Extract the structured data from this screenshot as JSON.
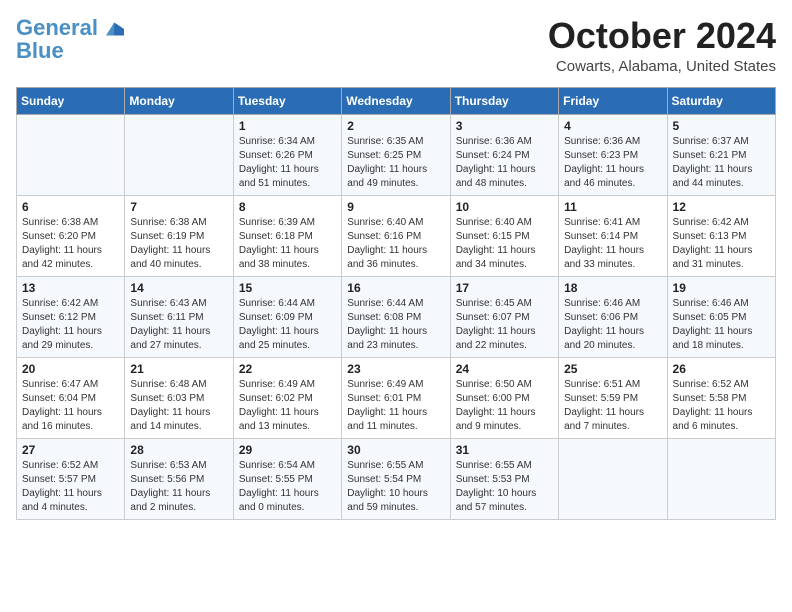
{
  "header": {
    "logo_line1": "General",
    "logo_line2": "Blue",
    "month": "October 2024",
    "location": "Cowarts, Alabama, United States"
  },
  "days_of_week": [
    "Sunday",
    "Monday",
    "Tuesday",
    "Wednesday",
    "Thursday",
    "Friday",
    "Saturday"
  ],
  "weeks": [
    [
      {
        "day": "",
        "content": ""
      },
      {
        "day": "",
        "content": ""
      },
      {
        "day": "1",
        "content": "Sunrise: 6:34 AM\nSunset: 6:26 PM\nDaylight: 11 hours\nand 51 minutes."
      },
      {
        "day": "2",
        "content": "Sunrise: 6:35 AM\nSunset: 6:25 PM\nDaylight: 11 hours\nand 49 minutes."
      },
      {
        "day": "3",
        "content": "Sunrise: 6:36 AM\nSunset: 6:24 PM\nDaylight: 11 hours\nand 48 minutes."
      },
      {
        "day": "4",
        "content": "Sunrise: 6:36 AM\nSunset: 6:23 PM\nDaylight: 11 hours\nand 46 minutes."
      },
      {
        "day": "5",
        "content": "Sunrise: 6:37 AM\nSunset: 6:21 PM\nDaylight: 11 hours\nand 44 minutes."
      }
    ],
    [
      {
        "day": "6",
        "content": "Sunrise: 6:38 AM\nSunset: 6:20 PM\nDaylight: 11 hours\nand 42 minutes."
      },
      {
        "day": "7",
        "content": "Sunrise: 6:38 AM\nSunset: 6:19 PM\nDaylight: 11 hours\nand 40 minutes."
      },
      {
        "day": "8",
        "content": "Sunrise: 6:39 AM\nSunset: 6:18 PM\nDaylight: 11 hours\nand 38 minutes."
      },
      {
        "day": "9",
        "content": "Sunrise: 6:40 AM\nSunset: 6:16 PM\nDaylight: 11 hours\nand 36 minutes."
      },
      {
        "day": "10",
        "content": "Sunrise: 6:40 AM\nSunset: 6:15 PM\nDaylight: 11 hours\nand 34 minutes."
      },
      {
        "day": "11",
        "content": "Sunrise: 6:41 AM\nSunset: 6:14 PM\nDaylight: 11 hours\nand 33 minutes."
      },
      {
        "day": "12",
        "content": "Sunrise: 6:42 AM\nSunset: 6:13 PM\nDaylight: 11 hours\nand 31 minutes."
      }
    ],
    [
      {
        "day": "13",
        "content": "Sunrise: 6:42 AM\nSunset: 6:12 PM\nDaylight: 11 hours\nand 29 minutes."
      },
      {
        "day": "14",
        "content": "Sunrise: 6:43 AM\nSunset: 6:11 PM\nDaylight: 11 hours\nand 27 minutes."
      },
      {
        "day": "15",
        "content": "Sunrise: 6:44 AM\nSunset: 6:09 PM\nDaylight: 11 hours\nand 25 minutes."
      },
      {
        "day": "16",
        "content": "Sunrise: 6:44 AM\nSunset: 6:08 PM\nDaylight: 11 hours\nand 23 minutes."
      },
      {
        "day": "17",
        "content": "Sunrise: 6:45 AM\nSunset: 6:07 PM\nDaylight: 11 hours\nand 22 minutes."
      },
      {
        "day": "18",
        "content": "Sunrise: 6:46 AM\nSunset: 6:06 PM\nDaylight: 11 hours\nand 20 minutes."
      },
      {
        "day": "19",
        "content": "Sunrise: 6:46 AM\nSunset: 6:05 PM\nDaylight: 11 hours\nand 18 minutes."
      }
    ],
    [
      {
        "day": "20",
        "content": "Sunrise: 6:47 AM\nSunset: 6:04 PM\nDaylight: 11 hours\nand 16 minutes."
      },
      {
        "day": "21",
        "content": "Sunrise: 6:48 AM\nSunset: 6:03 PM\nDaylight: 11 hours\nand 14 minutes."
      },
      {
        "day": "22",
        "content": "Sunrise: 6:49 AM\nSunset: 6:02 PM\nDaylight: 11 hours\nand 13 minutes."
      },
      {
        "day": "23",
        "content": "Sunrise: 6:49 AM\nSunset: 6:01 PM\nDaylight: 11 hours\nand 11 minutes."
      },
      {
        "day": "24",
        "content": "Sunrise: 6:50 AM\nSunset: 6:00 PM\nDaylight: 11 hours\nand 9 minutes."
      },
      {
        "day": "25",
        "content": "Sunrise: 6:51 AM\nSunset: 5:59 PM\nDaylight: 11 hours\nand 7 minutes."
      },
      {
        "day": "26",
        "content": "Sunrise: 6:52 AM\nSunset: 5:58 PM\nDaylight: 11 hours\nand 6 minutes."
      }
    ],
    [
      {
        "day": "27",
        "content": "Sunrise: 6:52 AM\nSunset: 5:57 PM\nDaylight: 11 hours\nand 4 minutes."
      },
      {
        "day": "28",
        "content": "Sunrise: 6:53 AM\nSunset: 5:56 PM\nDaylight: 11 hours\nand 2 minutes."
      },
      {
        "day": "29",
        "content": "Sunrise: 6:54 AM\nSunset: 5:55 PM\nDaylight: 11 hours\nand 0 minutes."
      },
      {
        "day": "30",
        "content": "Sunrise: 6:55 AM\nSunset: 5:54 PM\nDaylight: 10 hours\nand 59 minutes."
      },
      {
        "day": "31",
        "content": "Sunrise: 6:55 AM\nSunset: 5:53 PM\nDaylight: 10 hours\nand 57 minutes."
      },
      {
        "day": "",
        "content": ""
      },
      {
        "day": "",
        "content": ""
      }
    ]
  ]
}
